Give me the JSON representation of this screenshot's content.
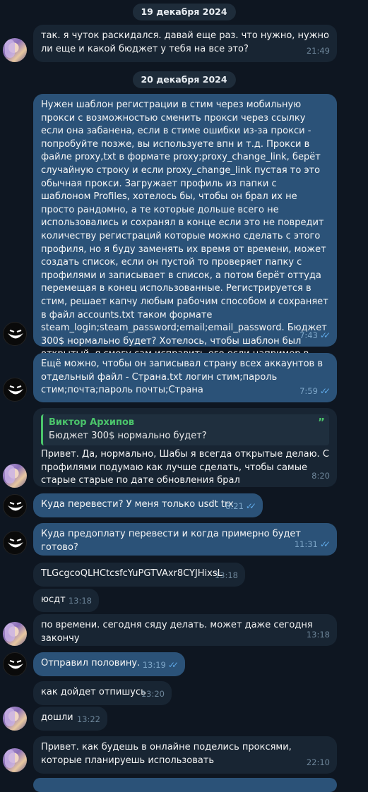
{
  "dates": {
    "d1": "19 декабря 2024",
    "d2": "20 декабря 2024"
  },
  "messages": [
    {
      "text": "так. я чуток раскидался. давай еще раз. что нужно, нужно ли еще и какой бюджет у тебя на все это?",
      "time": "21:49"
    },
    {
      "text": "Нужен шаблон регистрации в стим через мобильную прокси с возможностью сменить прокси через ссылку если она забанена, если в стиме ошибки из-за прокси - попробуйте позже, вы используете впн и т.д. Прокси в файле proxy,txt в формате proxy;proxy_change_link, берёт случайную строку и если proxy_change_link пустая то это обычная прокси. Загружает профиль из папки с шаблоном Profiles, хотелось бы, чтобы он брал их не просто рандомно, а те которые дольше всего не использовались и сохранял в конце если это не повредит количеству регистраций которые можно сделать с этого профиля, но я буду заменять их время от времени, может создать список, если он пустой то проверяет папку с профилями и записывает в список, а потом берёт оттуда перемещая в конец использованные. Регистрируется в стим, решает капчу любым рабочим способом и сохраняет в файл accounts.txt таком формате steam_login;steam_password;email;email_password. Бюджет 300$ нормально будет? Хотелось, чтобы шаблон был открытый, я смогу сам исправить его если например в почте что-то поменяют.",
      "time": "7:43"
    },
    {
      "text": "Ещё можно, чтобы он записывал страну всех аккаунтов в отдельный файл - Страна.txt логин стим;пароль стим;почта;пароль почты;Страна",
      "time": "7:59"
    },
    {
      "quote_name": "Виктор Архипов",
      "quote_text": "Бюджет 300$ нормально будет?",
      "text": "Привет. Да, нормально, Шабы я всегда открытые делаю. С профилями подумаю как лучше сделать, чтобы самые старые старые по дате обновления брал",
      "time": "8:20"
    },
    {
      "text": "Куда перевести? У меня только usdt trx",
      "time": "8:21"
    },
    {
      "text": "Куда предоплату перевести и когда примерно будет готово?",
      "time": "11:31"
    },
    {
      "text": "TLGcgcoQLHCtcsfcYuPGTVAxr8CYJHixsL",
      "time": "13:18"
    },
    {
      "text": "юсдт",
      "time": "13:18"
    },
    {
      "text": "по времени. сегодня сяду делать. может даже сегодня закончу",
      "time": "13:18"
    },
    {
      "text": "Отправил половину.",
      "time": "13:19"
    },
    {
      "text": "как дойдет отпишусь",
      "time": "13:20"
    },
    {
      "text": "дошли",
      "time": "13:22"
    },
    {
      "text": "Привет. как будешь в онлайне поделись проксями, которые планируешь использовать",
      "time": "22:10"
    }
  ],
  "colors": {
    "background": "#0e1621",
    "incoming_bubble": "#182533",
    "outgoing_bubble": "#2b5278",
    "quote_accent": "#4bc46b",
    "read_check": "#5fa9e8"
  },
  "icons": {
    "read": "double-check-icon",
    "quote": "quote-mark-icon"
  }
}
